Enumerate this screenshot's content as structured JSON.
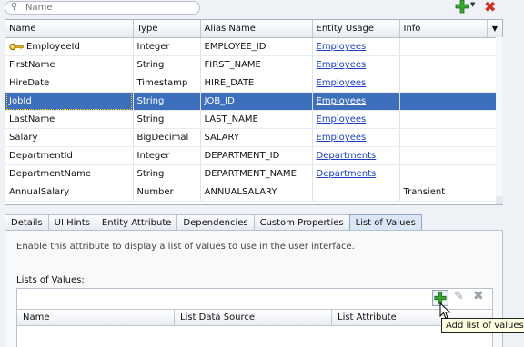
{
  "toolbar": {
    "search_placeholder": "Name",
    "search_icon": "search-icon",
    "add_icon": "add-icon",
    "dropdown_icon": "chevron-down-icon",
    "delete_icon": "delete-icon"
  },
  "attributes_table": {
    "columns": [
      "Name",
      "Type",
      "Alias Name",
      "Entity Usage",
      "Info"
    ],
    "rows": [
      {
        "name": "EmployeeId",
        "type": "Integer",
        "alias": "EMPLOYEE_ID",
        "entity": "Employees",
        "info": "",
        "key": true
      },
      {
        "name": "FirstName",
        "type": "String",
        "alias": "FIRST_NAME",
        "entity": "Employees",
        "info": ""
      },
      {
        "name": "HireDate",
        "type": "Timestamp",
        "alias": "HIRE_DATE",
        "entity": "Employees",
        "info": ""
      },
      {
        "name": "JobId",
        "type": "String",
        "alias": "JOB_ID",
        "entity": "Employees",
        "info": "",
        "selected": true
      },
      {
        "name": "LastName",
        "type": "String",
        "alias": "LAST_NAME",
        "entity": "Employees",
        "info": ""
      },
      {
        "name": "Salary",
        "type": "BigDecimal",
        "alias": "SALARY",
        "entity": "Employees",
        "info": ""
      },
      {
        "name": "DepartmentId",
        "type": "Integer",
        "alias": "DEPARTMENT_ID",
        "entity": "Departments",
        "info": ""
      },
      {
        "name": "DepartmentName",
        "type": "String",
        "alias": "DEPARTMENT_NAME",
        "entity": "Departments",
        "info": ""
      },
      {
        "name": "AnnualSalary",
        "type": "Number",
        "alias": "ANNUALSALARY",
        "entity": "",
        "info": "Transient"
      }
    ]
  },
  "tabs": [
    {
      "label": "Details"
    },
    {
      "label": "UI Hints"
    },
    {
      "label": "Entity Attribute"
    },
    {
      "label": "Dependencies"
    },
    {
      "label": "Custom Properties"
    },
    {
      "label": "List of Values",
      "active": true
    }
  ],
  "lov_panel": {
    "description": "Enable this attribute to display a list of values to use in the user interface.",
    "lists_label": "Lists of Values:",
    "columns": [
      "Name",
      "List Data Source",
      "List Attribute"
    ],
    "tooltip": "Add list of values",
    "add_icon": "add-icon",
    "edit_icon": "pencil-icon",
    "delete_icon": "delete-icon"
  },
  "colors": {
    "selection": "#3d6fbd",
    "link": "#1b3fc0",
    "add_green": "#2e9b26",
    "delete_red": "#d52a1b"
  }
}
